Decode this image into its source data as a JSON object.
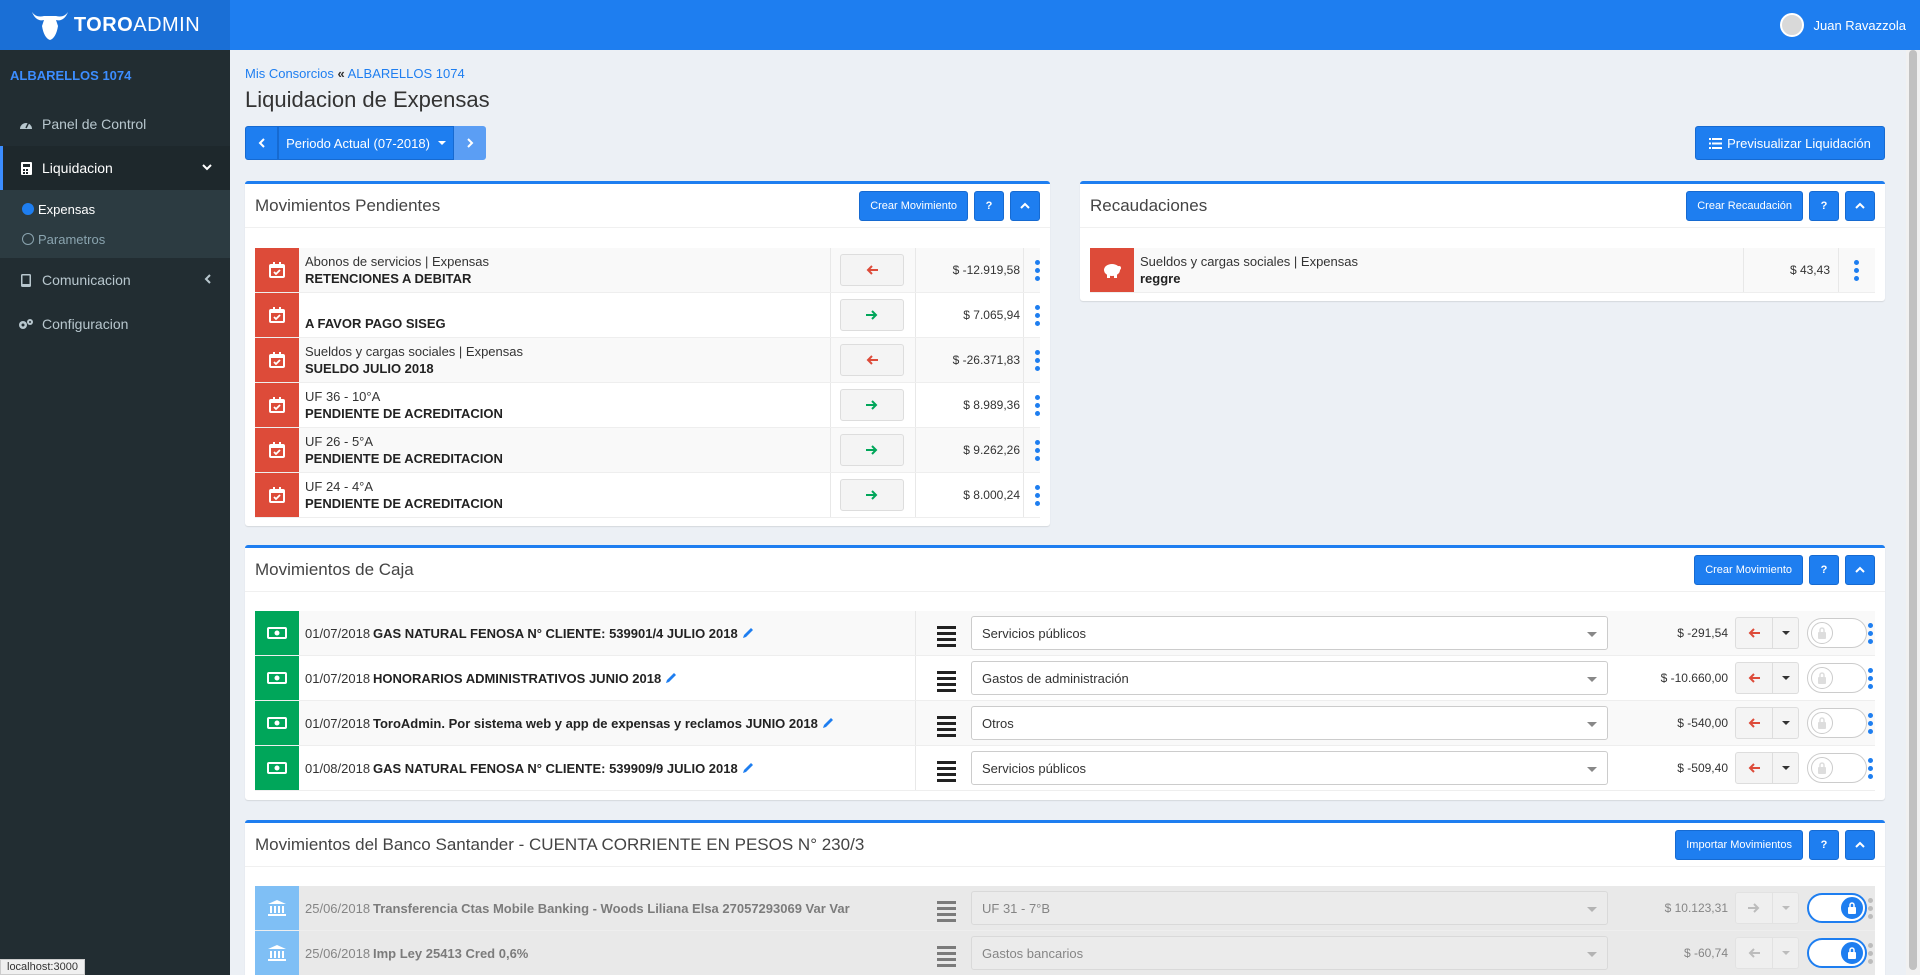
{
  "app": {
    "logo_bold": "TORO",
    "logo_light": "ADMIN",
    "user_name": "Juan Ravazzola",
    "status_url": "localhost:3000"
  },
  "sidebar": {
    "consorcio": "ALBARELLOS 1074",
    "items": [
      {
        "label": "Panel de Control",
        "icon": "dashboard-icon"
      },
      {
        "label": "Liquidacion",
        "icon": "calculator-icon"
      },
      {
        "label": "Comunicacion",
        "icon": "tablet-icon"
      },
      {
        "label": "Configuracion",
        "icon": "gears-icon"
      }
    ],
    "subitems": [
      {
        "label": "Expensas"
      },
      {
        "label": "Parametros"
      }
    ]
  },
  "breadcrumb": {
    "root": "Mis Consorcios",
    "current": "ALBARELLOS 1074"
  },
  "page_title": "Liquidacion de Expensas",
  "period": {
    "label": "Periodo Actual (07-2018)"
  },
  "preview_label": "Previsualizar Liquidación",
  "pendientes": {
    "title": "Movimientos Pendientes",
    "create_label": "Crear Movimiento",
    "help_label": "?",
    "rows": [
      {
        "sub": "Abonos de servicios | Expensas",
        "main": "RETENCIONES A DEBITAR",
        "dir": "left",
        "amount": "$ -12.919,58"
      },
      {
        "sub": "",
        "main": "A FAVOR PAGO SISEG",
        "dir": "right",
        "amount": "$ 7.065,94"
      },
      {
        "sub": "Sueldos y cargas sociales | Expensas",
        "main": "SUELDO JULIO 2018",
        "dir": "left",
        "amount": "$ -26.371,83"
      },
      {
        "sub": "UF 36 - 10°A",
        "main": "PENDIENTE DE ACREDITACION",
        "dir": "right",
        "amount": "$ 8.989,36"
      },
      {
        "sub": "UF 26 - 5°A",
        "main": "PENDIENTE DE ACREDITACION",
        "dir": "right",
        "amount": "$ 9.262,26"
      },
      {
        "sub": "UF 24 - 4°A",
        "main": "PENDIENTE DE ACREDITACION",
        "dir": "right",
        "amount": "$ 8.000,24"
      }
    ]
  },
  "recaudaciones": {
    "title": "Recaudaciones",
    "create_label": "Crear Recaudación",
    "help_label": "?",
    "rows": [
      {
        "sub": "Sueldos y cargas sociales | Expensas",
        "main": "reggre",
        "amount": "$ 43,43"
      }
    ]
  },
  "caja": {
    "title": "Movimientos de Caja",
    "create_label": "Crear Movimiento",
    "help_label": "?",
    "rows": [
      {
        "date": "01/07/2018",
        "desc": "GAS NATURAL FENOSA N° CLIENTE: 539901/4 JULIO 2018",
        "category": "Servicios públicos",
        "amount": "$ -291,54"
      },
      {
        "date": "01/07/2018",
        "desc": "HONORARIOS ADMINISTRATIVOS JUNIO 2018",
        "category": "Gastos de administración",
        "amount": "$ -10.660,00"
      },
      {
        "date": "01/07/2018",
        "desc": "ToroAdmin. Por sistema web y app de expensas y reclamos JUNIO 2018",
        "category": "Otros",
        "amount": "$ -540,00"
      },
      {
        "date": "01/08/2018",
        "desc": "GAS NATURAL FENOSA N° CLIENTE: 539909/9 JULIO 2018",
        "category": "Servicios públicos",
        "amount": "$ -509,40"
      }
    ]
  },
  "banco": {
    "title": "Movimientos del Banco Santander - CUENTA CORRIENTE EN PESOS N° 230/3",
    "import_label": "Importar Movimientos",
    "help_label": "?",
    "rows": [
      {
        "date": "25/06/2018",
        "desc": "Transferencia Ctas Mobile Banking - Woods Liliana Elsa 27057293069 Var Var",
        "category": "UF 31 - 7°B",
        "amount": "$ 10.123,31"
      },
      {
        "date": "25/06/2018",
        "desc": "Imp Ley 25413 Cred 0,6%",
        "category": "Gastos bancarios",
        "amount": "$ -60,74"
      }
    ]
  },
  "colors": {
    "primary": "#1e7ef0",
    "danger": "#dd4b39",
    "success": "#00a65a",
    "sidebar": "#222d32"
  }
}
